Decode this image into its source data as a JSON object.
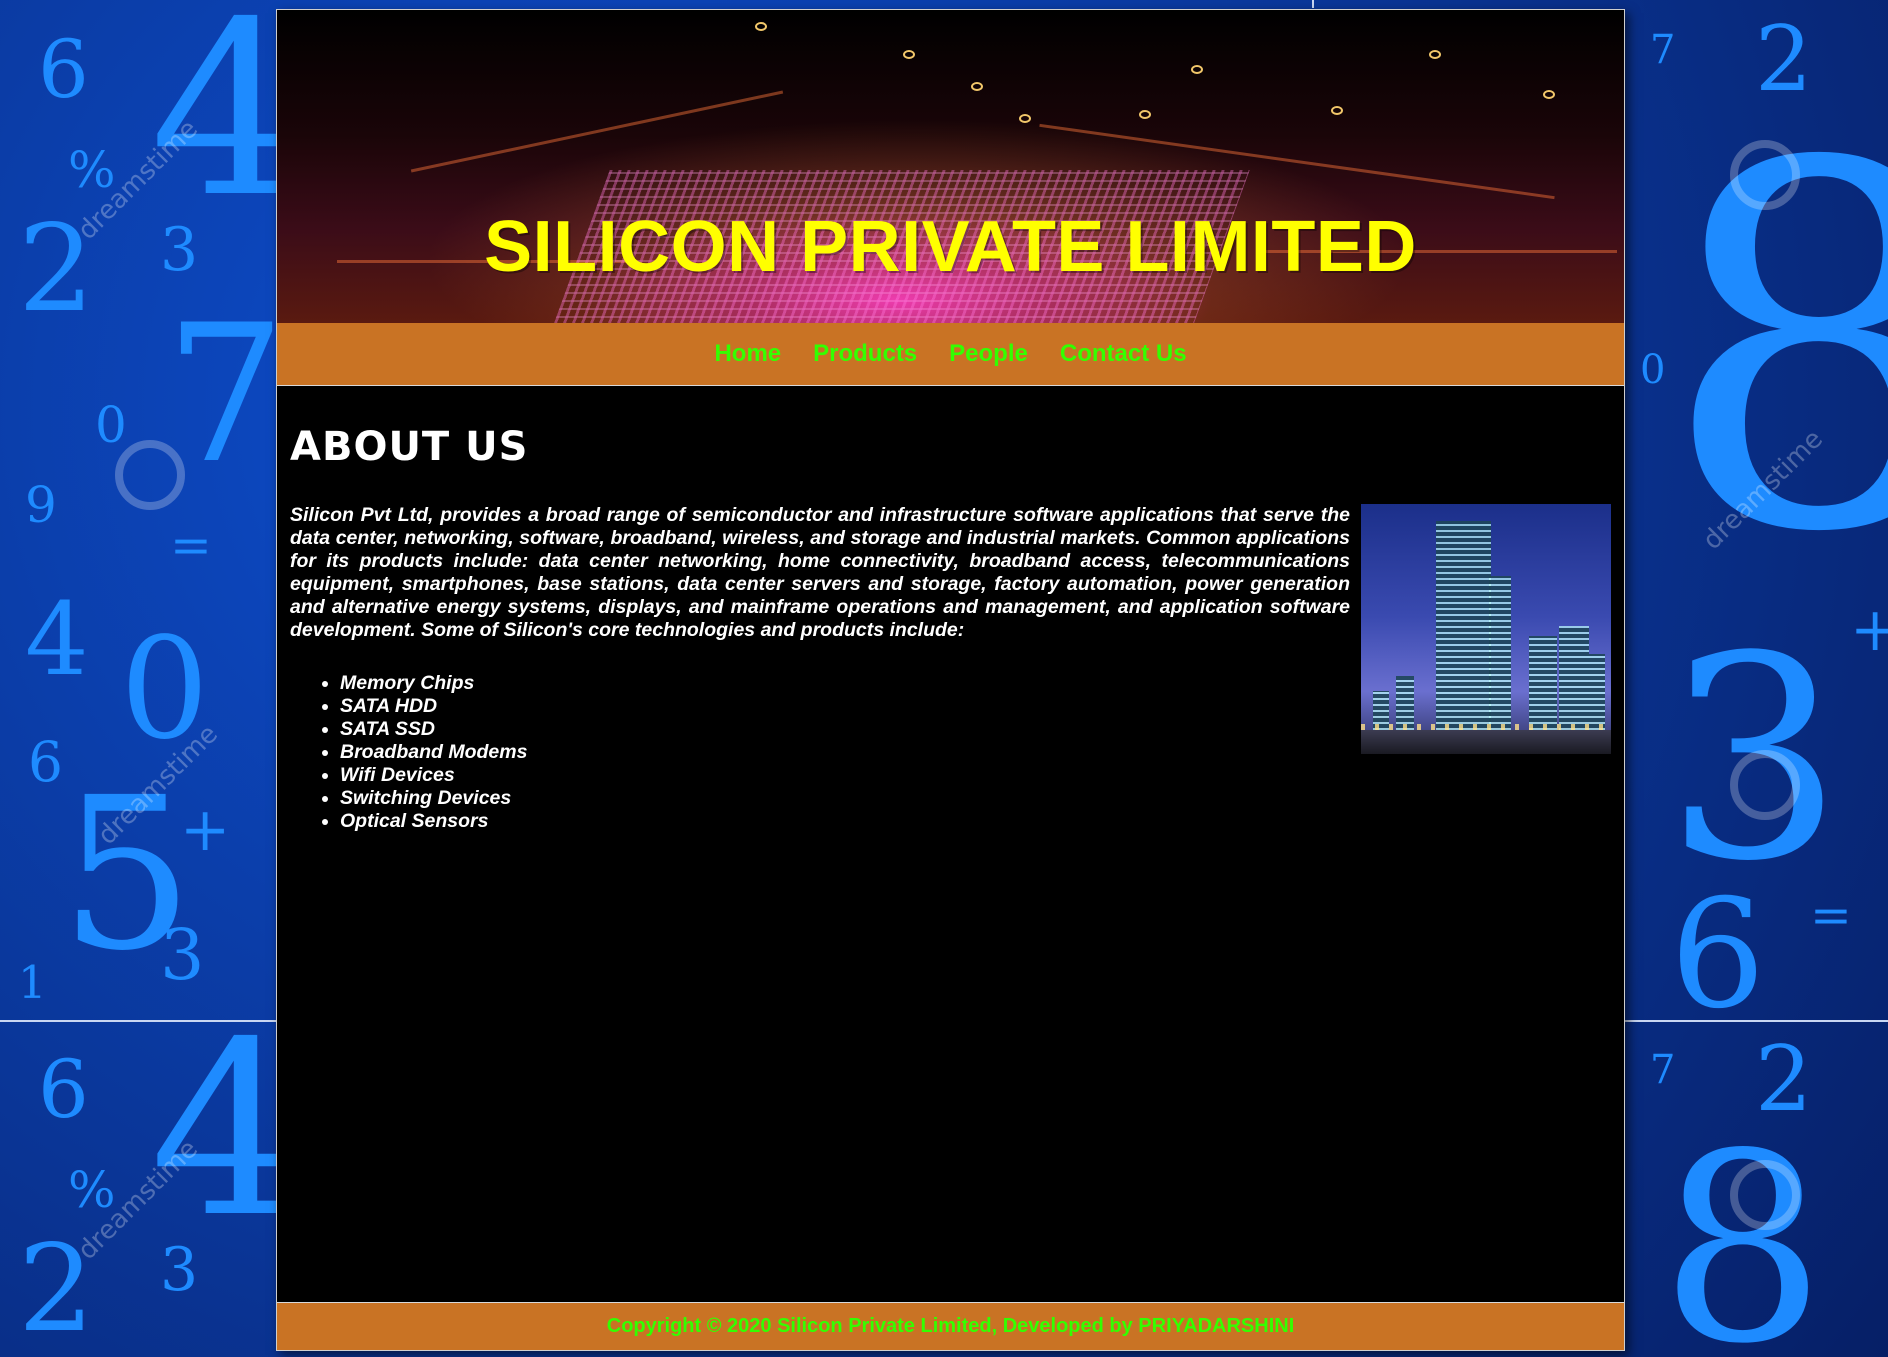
{
  "banner": {
    "title": "SILICON PRIVATE LIMITED"
  },
  "nav": {
    "items": [
      {
        "label": "Home"
      },
      {
        "label": "Products"
      },
      {
        "label": "People"
      },
      {
        "label": "Contact Us"
      }
    ]
  },
  "main": {
    "heading": "ABOUT US",
    "paragraph": "Silicon Pvt Ltd, provides a broad range of semiconductor and infrastructure software applications that serve the data center, networking, software, broadband, wireless, and storage and industrial markets. Common applications for its products include: data center networking, home connectivity, broadband access, telecommunications equipment, smartphones, base stations, data center servers and storage, factory automation, power generation and alternative energy systems, displays, and mainframe operations and management, and application software development. Some of Silicon's core technologies and products include:",
    "products": [
      "Memory Chips",
      "SATA HDD",
      "SATA SSD",
      "Broadband Modems",
      "Wifi Devices",
      "Switching Devices",
      "Optical Sensors"
    ]
  },
  "footer": {
    "text": "Copyright © 2020 Silicon Private Limited, Developed by PRIYADARSHINI"
  },
  "colors": {
    "nav_bg": "#c97324",
    "nav_text": "#33ff00",
    "title": "#ffff00",
    "page_bg": "#000000"
  }
}
